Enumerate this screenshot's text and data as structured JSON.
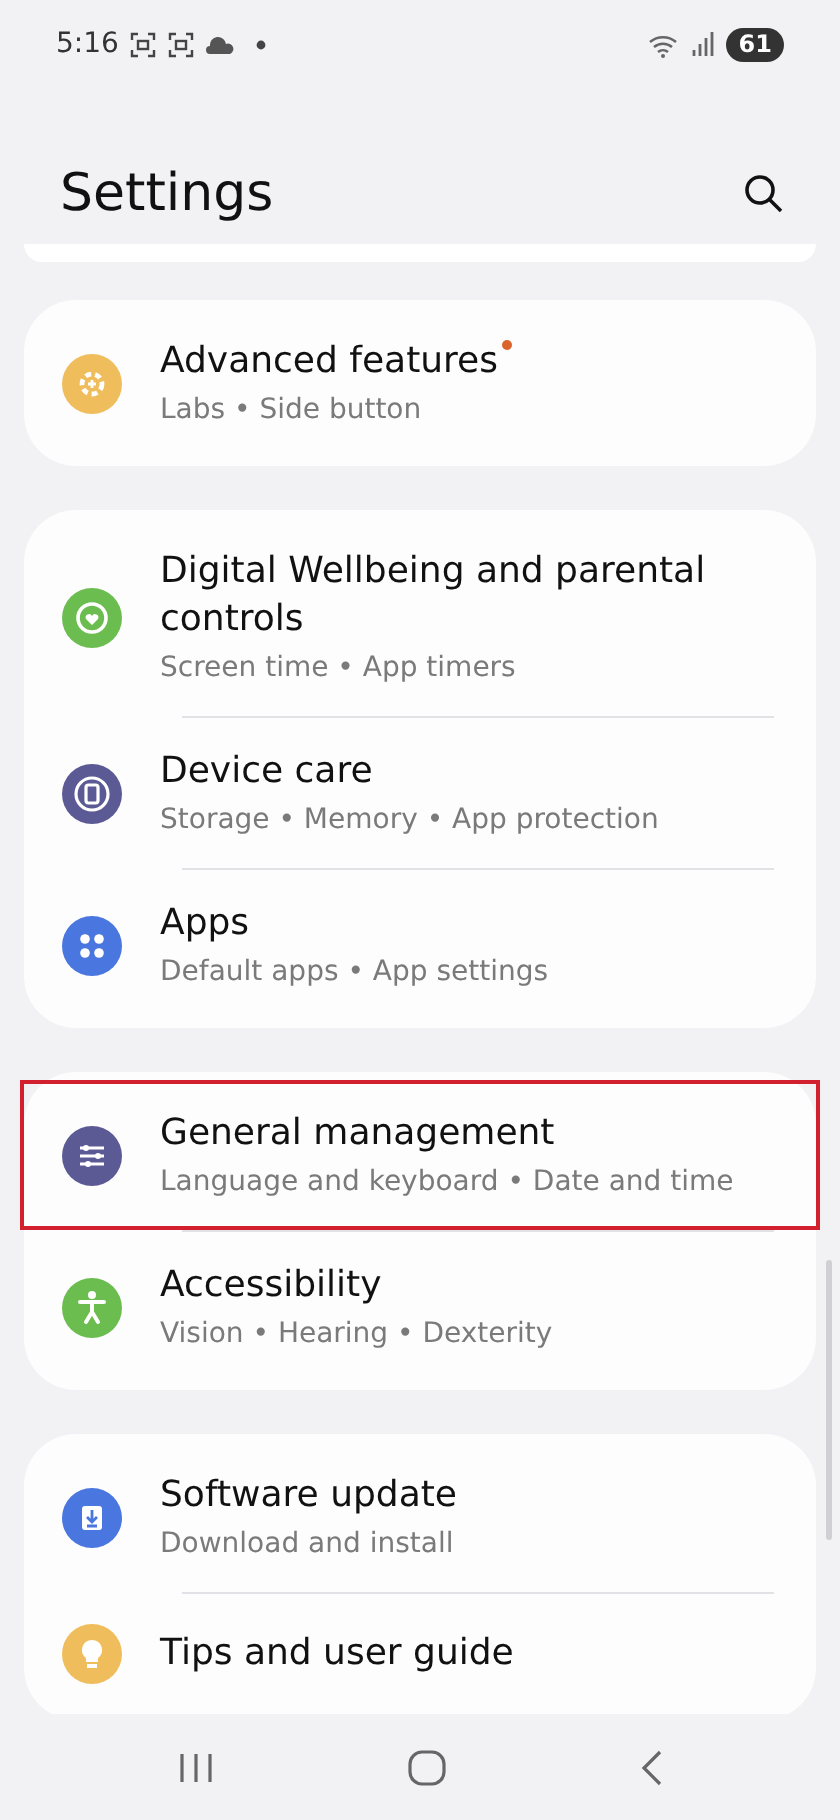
{
  "status_bar": {
    "time": "5:16",
    "battery": "61"
  },
  "header": {
    "title": "Settings"
  },
  "groups": [
    {
      "items": [
        {
          "title": "Advanced features",
          "subtitle": "Labs • Side button",
          "color": "#f0bd5c",
          "badge": true,
          "highlighted": false
        }
      ]
    },
    {
      "items": [
        {
          "title": "Digital Wellbeing and parental controls",
          "subtitle": "Screen time • App timers",
          "color": "#6cbd4f",
          "badge": false,
          "highlighted": false
        },
        {
          "title": "Device care",
          "subtitle": "Storage • Memory • App protection",
          "color": "#5c5a94",
          "badge": false,
          "highlighted": false
        },
        {
          "title": "Apps",
          "subtitle": "Default apps • App settings",
          "color": "#4a76e0",
          "badge": false,
          "highlighted": false
        }
      ]
    },
    {
      "items": [
        {
          "title": "General management",
          "subtitle": "Language and keyboard • Date and time",
          "color": "#5c5a94",
          "badge": false,
          "highlighted": true
        },
        {
          "title": "Accessibility",
          "subtitle": "Vision • Hearing • Dexterity",
          "color": "#6cbd4f",
          "badge": false,
          "highlighted": false
        }
      ]
    },
    {
      "items": [
        {
          "title": "Software update",
          "subtitle": "Download and install",
          "color": "#4a76e0",
          "badge": false,
          "highlighted": false
        },
        {
          "title": "Tips and user guide",
          "color": "#f0bd5c",
          "badge": false,
          "highlighted": false
        }
      ]
    }
  ]
}
